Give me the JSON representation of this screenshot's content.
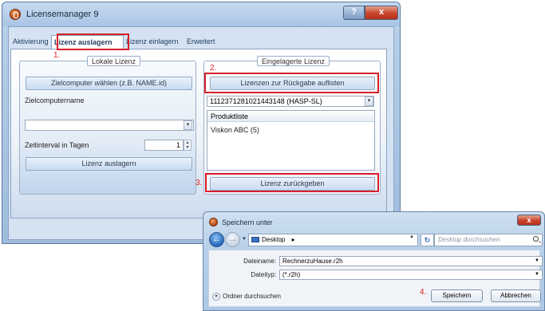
{
  "app": {
    "title": "Licensemanager 9",
    "help_label": "?",
    "close_label": "x"
  },
  "tabs": [
    {
      "label": "Aktivierung"
    },
    {
      "label": "Lizenz auslagern",
      "active": true
    },
    {
      "label": "Lizenz einlagern"
    },
    {
      "label": "Erweitert"
    }
  ],
  "steps": {
    "one": "1.",
    "two": "2.",
    "three": "3.",
    "four": "4."
  },
  "local": {
    "legend": "Lokale Lizenz",
    "choose_button": "Zielcomputer wählen (z.B. NAME.id)",
    "name_label": "Zielcomputername",
    "name_value": "",
    "interval_label": "Zeitinterval in Tagen",
    "interval_value": "1",
    "export_button": "Lizenz auslagern"
  },
  "stored": {
    "legend": "Eingelagerte Lizenz",
    "list_button": "Lizenzen zur Rückgabe auflisten",
    "selected_license": "1112371281021443148 (HASP-SL)",
    "product_header": "Produktliste",
    "products": [
      "Viskon ABC (5)"
    ],
    "return_button": "Lizenz zurückgeben"
  },
  "save_dialog": {
    "title": "Speichern unter",
    "close_label": "x",
    "location": "Desktop",
    "location_arrow": "▸",
    "search_placeholder": "Desktop durchsuchen",
    "filename_label": "Dateiname:",
    "filename_value": "RechnerzuHause.r2h",
    "filetype_label": "Dateityp:",
    "filetype_value": "(*.r2h)",
    "browse_label": "Ordner durchsuchen",
    "save_button": "Speichern",
    "cancel_button": "Abbrechen"
  },
  "colors": {
    "highlight": "#d81f2a",
    "window_frame": "#a9c4e2",
    "close_red": "#c8442a"
  }
}
